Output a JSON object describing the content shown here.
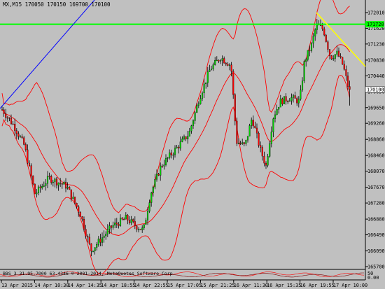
{
  "window": {
    "symbol": "MX,M15",
    "ohlc": "170050 170150 169700 170100"
  },
  "indicator": {
    "title": "BBS 3 31.95.7000 63.4346",
    "subtitle": "© 2001-2014, MetaQuotes Software Corp."
  },
  "price_axis": {
    "ticks": [
      "172010",
      "171620",
      "171230",
      "170830",
      "170440",
      "170050",
      "169650",
      "169260",
      "168860",
      "168460",
      "168070",
      "167670",
      "167280",
      "166880",
      "166490",
      "166090",
      "165700"
    ],
    "current_price": "170100",
    "hline_price": "171720"
  },
  "time_axis": {
    "ticks": [
      "13 Apr 2015",
      "14 Apr 10:30",
      "14 Apr 14:35",
      "14 Apr 18:55",
      "14 Apr 22:55",
      "15 Apr 17:05",
      "15 Apr 21:25",
      "16 Apr 11:30",
      "16 Apr 15:35",
      "16 Apr 19:55",
      "17 Apr 10:00"
    ]
  },
  "indicator_axis": {
    "ticks": [
      "50",
      "0.00"
    ]
  },
  "colors": {
    "background": "#c0c0c0",
    "bull": "#00d000",
    "bear": "#ff0000",
    "band": "#ff0000",
    "hline": "#00ff00",
    "trendline_blue": "#0000ff",
    "trendline_yellow": "#ffff00",
    "grid": "#808080"
  }
}
